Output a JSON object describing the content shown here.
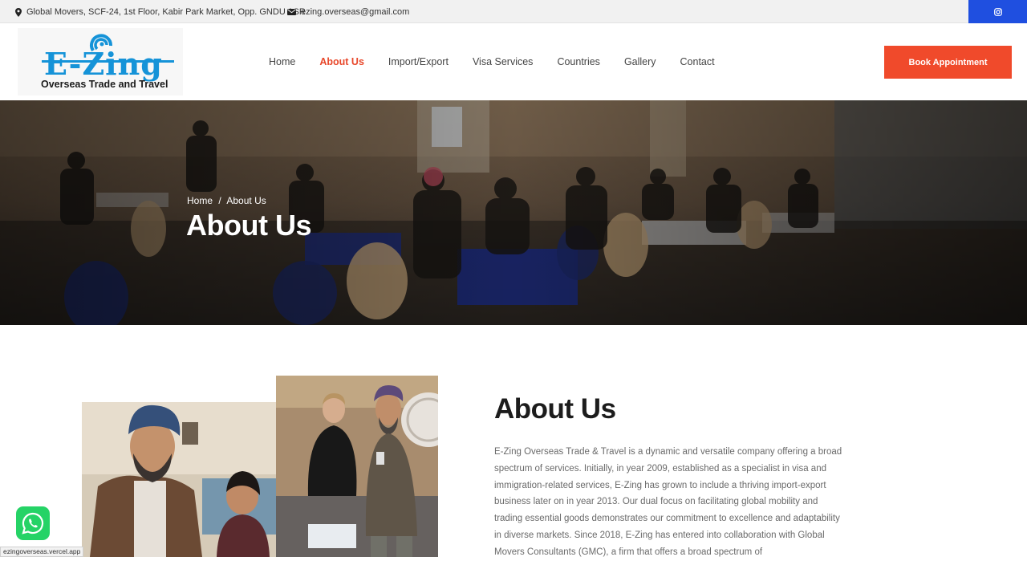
{
  "topbar": {
    "address": "Global Movers, SCF-24, 1st Floor, Kabir Park Market, Opp. GNDU ASR",
    "email": "ezing.overseas@gmail.com",
    "social_icon": "instagram-icon"
  },
  "logo": {
    "wordmark": "E-Zing",
    "tagline": "Overseas Trade and Travel"
  },
  "nav": {
    "items": [
      {
        "label": "Home"
      },
      {
        "label": "About Us"
      },
      {
        "label": "Import/Export"
      },
      {
        "label": "Visa Services"
      },
      {
        "label": "Countries"
      },
      {
        "label": "Gallery"
      },
      {
        "label": "Contact"
      }
    ],
    "active_index": 1,
    "book_label": "Book Appointment"
  },
  "hero": {
    "breadcrumb_home": "Home",
    "breadcrumb_sep": "/",
    "breadcrumb_current": "About Us",
    "title": "About Us"
  },
  "about": {
    "title": "About Us",
    "body": "E-Zing Overseas Trade & Travel is a dynamic and versatile company offering a broad spectrum of services. Initially, in year 2009, established as a specialist in visa and immigration-related services, E-Zing has grown to include a thriving import-export business later on in year 2013. Our dual focus on facilitating global mobility and trading essential goods demonstrates our commitment to excellence and adaptability in diverse markets. Since 2018, E-Zing has entered into collaboration with Global Movers Consultants (GMC), a firm that offers a broad spectrum of"
  },
  "status_url": "ezingoverseas.vercel.app",
  "colors": {
    "accent": "#f04a2b",
    "active_nav": "#e8472a",
    "social_bg": "#1f4fe0",
    "brand_blue": "#1593d8",
    "whatsapp": "#25d366"
  }
}
